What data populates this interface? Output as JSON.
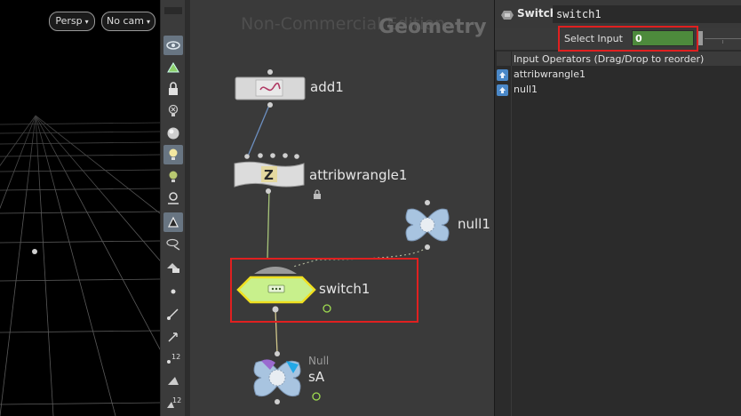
{
  "viewport": {
    "persp_label": "Persp",
    "cam_label": "No cam"
  },
  "network": {
    "watermark": "Non-Commercial Edition",
    "context_label": "Geometry",
    "nodes": {
      "add": {
        "name": "add1"
      },
      "wrangle": {
        "name": "attribwrangle1"
      },
      "null": {
        "name": "null1"
      },
      "switch": {
        "name": "switch1"
      },
      "sa": {
        "type": "Null",
        "name": "sA"
      }
    }
  },
  "params": {
    "node_type": "Switch",
    "node_name": "switch1",
    "select_input_label": "Select Input",
    "select_input_value": "0",
    "list_header": "Input Operators (Drag/Drop to reorder)",
    "inputs": [
      "attribwrangle1",
      "null1"
    ]
  },
  "colors": {
    "highlight": "#e02020",
    "value_field": "#4d8a3c",
    "switch_node": "#c8f08c",
    "selected_outline": "#f0e020"
  }
}
